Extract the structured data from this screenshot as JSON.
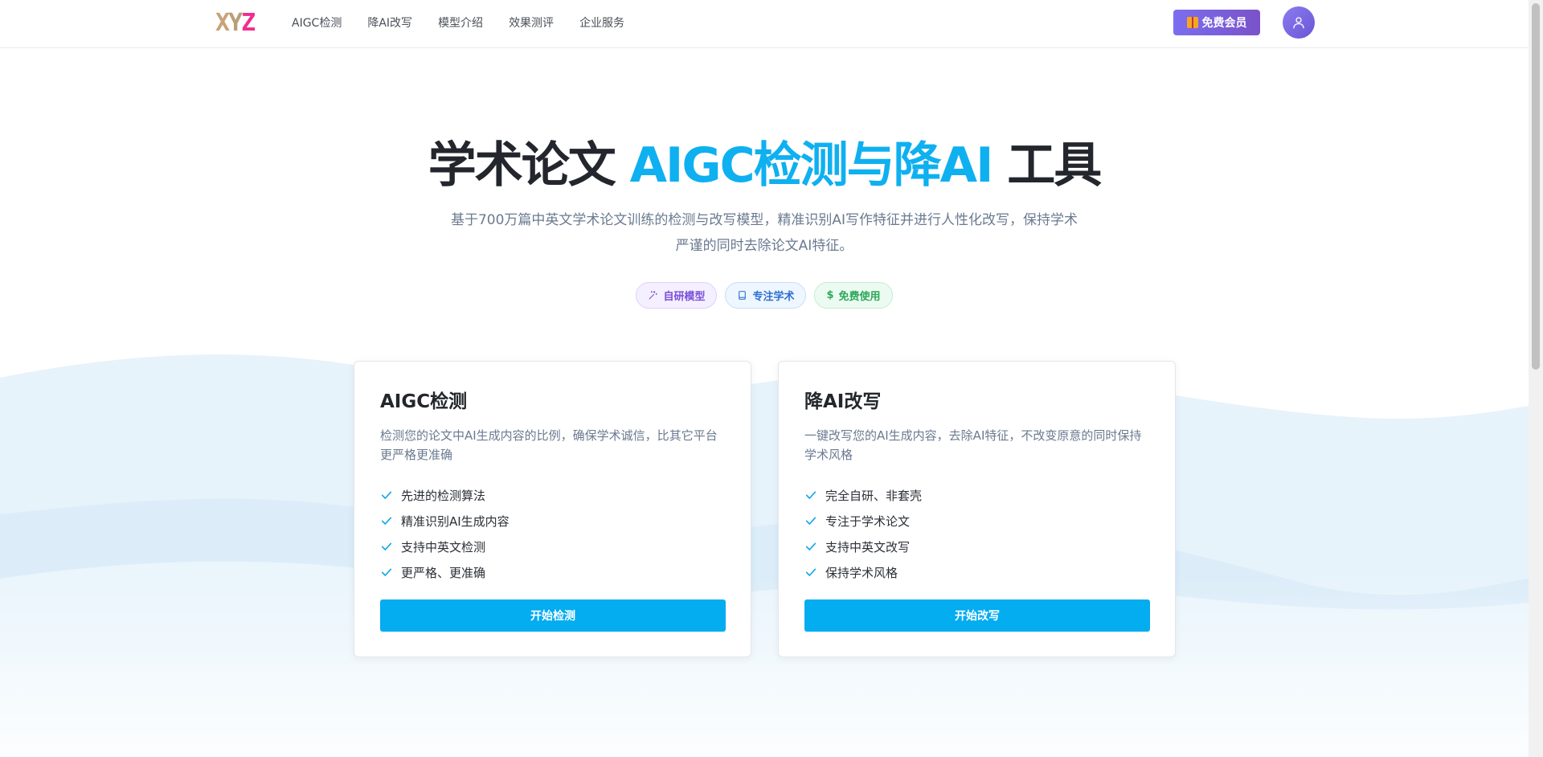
{
  "brand": {
    "logo_parts": [
      "X",
      "Y",
      "Z"
    ],
    "colors": {
      "primary": "#04acf0",
      "accent_text": "#0fb0f0",
      "vip_start": "#7b6ef0",
      "vip_end": "#7a52c8"
    }
  },
  "nav": {
    "links": [
      {
        "label": "AIGC检测"
      },
      {
        "label": "降AI改写"
      },
      {
        "label": "模型介绍"
      },
      {
        "label": "效果测评"
      },
      {
        "label": "企业服务"
      }
    ],
    "vip_label": "免费会员",
    "vip_icon": "gift-icon",
    "avatar_icon": "user-icon"
  },
  "hero": {
    "title_part1": "学术论文 ",
    "title_accent": "AIGC检测与降AI",
    "title_part2": " 工具",
    "subtitle": "基于700万篇中英文学术论文训练的检测与改写模型，精准识别AI写作特征并进行人性化改写，保持学术严谨的同时去除论文AI特征。",
    "tags": [
      {
        "label": "自研模型",
        "icon": "wand-icon"
      },
      {
        "label": "专注学术",
        "icon": "book-icon"
      },
      {
        "label": "免费使用",
        "icon": "dollar-icon"
      }
    ]
  },
  "cards": [
    {
      "title": "AIGC检测",
      "description": "检测您的论文中AI生成内容的比例，确保学术诚信，比其它平台更严格更准确",
      "features": [
        "先进的检测算法",
        "精准识别AI生成内容",
        "支持中英文检测",
        "更严格、更准确"
      ],
      "button": "开始检测"
    },
    {
      "title": "降AI改写",
      "description": "一键改写您的AI生成内容，去除AI特征，不改变原意的同时保持学术风格",
      "features": [
        "完全自研、非套壳",
        "专注于学术论文",
        "支持中英文改写",
        "保持学术风格"
      ],
      "button": "开始改写"
    }
  ]
}
